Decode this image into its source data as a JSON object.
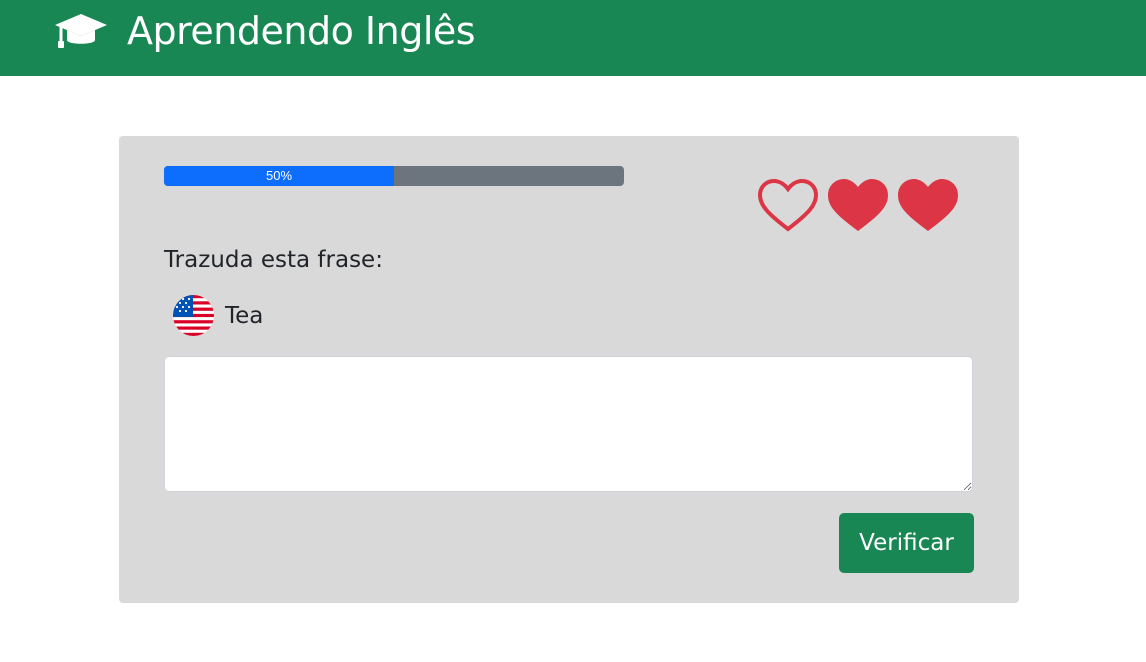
{
  "header": {
    "title": "Aprendendo Inglês",
    "icon": "graduation-cap-icon"
  },
  "exercise": {
    "progress": {
      "label": "50%",
      "value": 0.5
    },
    "lives": {
      "total": 3,
      "remaining": 2,
      "icons": [
        "heart-outline-icon",
        "heart-filled-icon",
        "heart-filled-icon"
      ]
    },
    "prompt": "Trazuda esta frase:",
    "phrase": {
      "flag": "us-flag-icon",
      "text": "Tea"
    },
    "answer": {
      "value": ""
    },
    "verify_label": "Verificar"
  },
  "colors": {
    "brand": "#198754",
    "progress": "#0d6efd",
    "heart": "#dc3545",
    "card": "#d9d9d9"
  }
}
